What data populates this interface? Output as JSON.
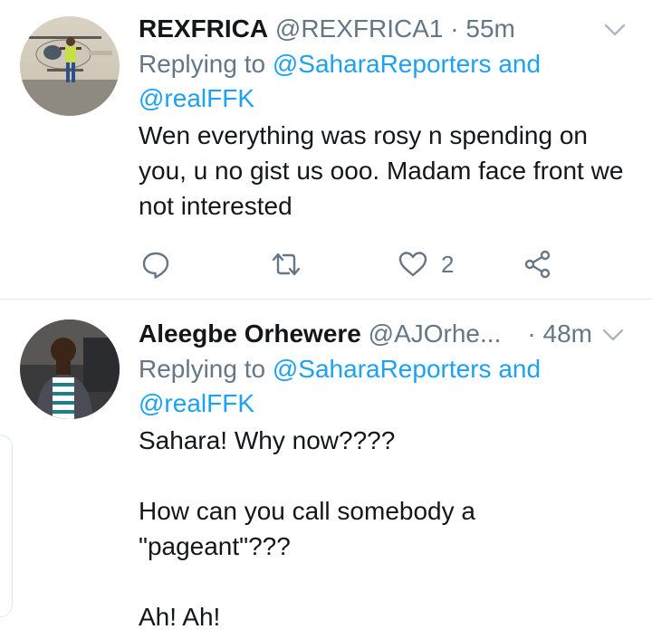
{
  "tweets": [
    {
      "display_name": "REXFRICA",
      "handle": "@REXFRICA1",
      "separator": "·",
      "time": "55m",
      "reply_prefix": "Replying to",
      "reply_mention_1": "@SaharaReporters",
      "reply_conjunction": "and",
      "reply_mention_2": "@realFFK",
      "text": "Wen everything was rosy n spending on you, u no gist us ooo. Madam face front we not interested",
      "like_count": "2",
      "avatar_icon": "user-avatar-photo"
    },
    {
      "display_name": "Aleegbe Orhewere",
      "handle": "@AJOrhe...",
      "separator": "·",
      "time": "48m",
      "reply_prefix": "Replying to",
      "reply_mention_1": "@SaharaReporters",
      "reply_conjunction": "and",
      "reply_mention_2": "@realFFK",
      "text": "Sahara! Why now????\n\nHow can you call somebody a \"pageant\"???\n\nAh! Ah!",
      "avatar_icon": "user-avatar-photo"
    }
  ],
  "icons": {
    "reply": "reply-icon",
    "retweet": "retweet-icon",
    "like": "heart-icon",
    "share": "share-icon",
    "menu": "chevron-down-icon"
  },
  "colors": {
    "link": "#1da1f2",
    "secondary_text": "#657786",
    "primary_text": "#14171a",
    "divider": "#e1e8ed"
  }
}
